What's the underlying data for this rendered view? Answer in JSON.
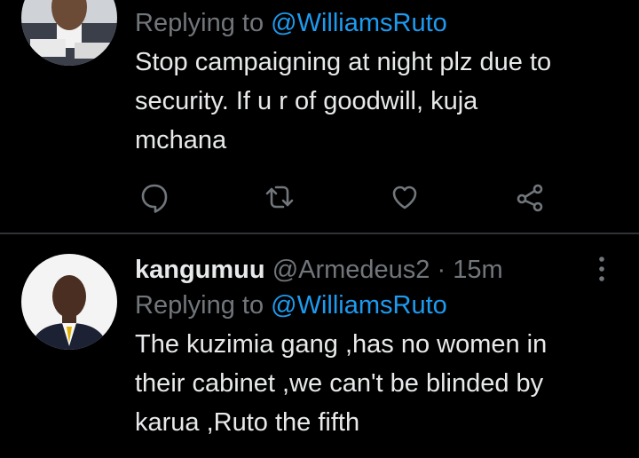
{
  "tweets": [
    {
      "replying_prefix": "Replying to ",
      "replying_to": "@WilliamsRuto",
      "text_lines": [
        "Stop campaigning at night plz due to",
        "security. If u r of goodwill, kuja",
        "mchana"
      ]
    },
    {
      "name": "kangumuu",
      "handle": "@Armedeus2",
      "separator": "·",
      "time": "15m",
      "replying_prefix": "Replying to ",
      "replying_to": "@WilliamsRuto",
      "text_lines": [
        "The kuzimia gang ,has no women in",
        "their cabinet ,we can't be blinded by",
        "karua ,Ruto the fifth"
      ]
    }
  ],
  "icons": {
    "reply": "comment-bubble-icon",
    "retweet": "retweet-icon",
    "like": "heart-icon",
    "share": "share-icon",
    "more": "more-vertical-icon"
  },
  "colors": {
    "background": "#000000",
    "text": "#e7e9ea",
    "secondary": "#71767b",
    "accent": "#1d9bf0",
    "divider": "#2f3336"
  }
}
